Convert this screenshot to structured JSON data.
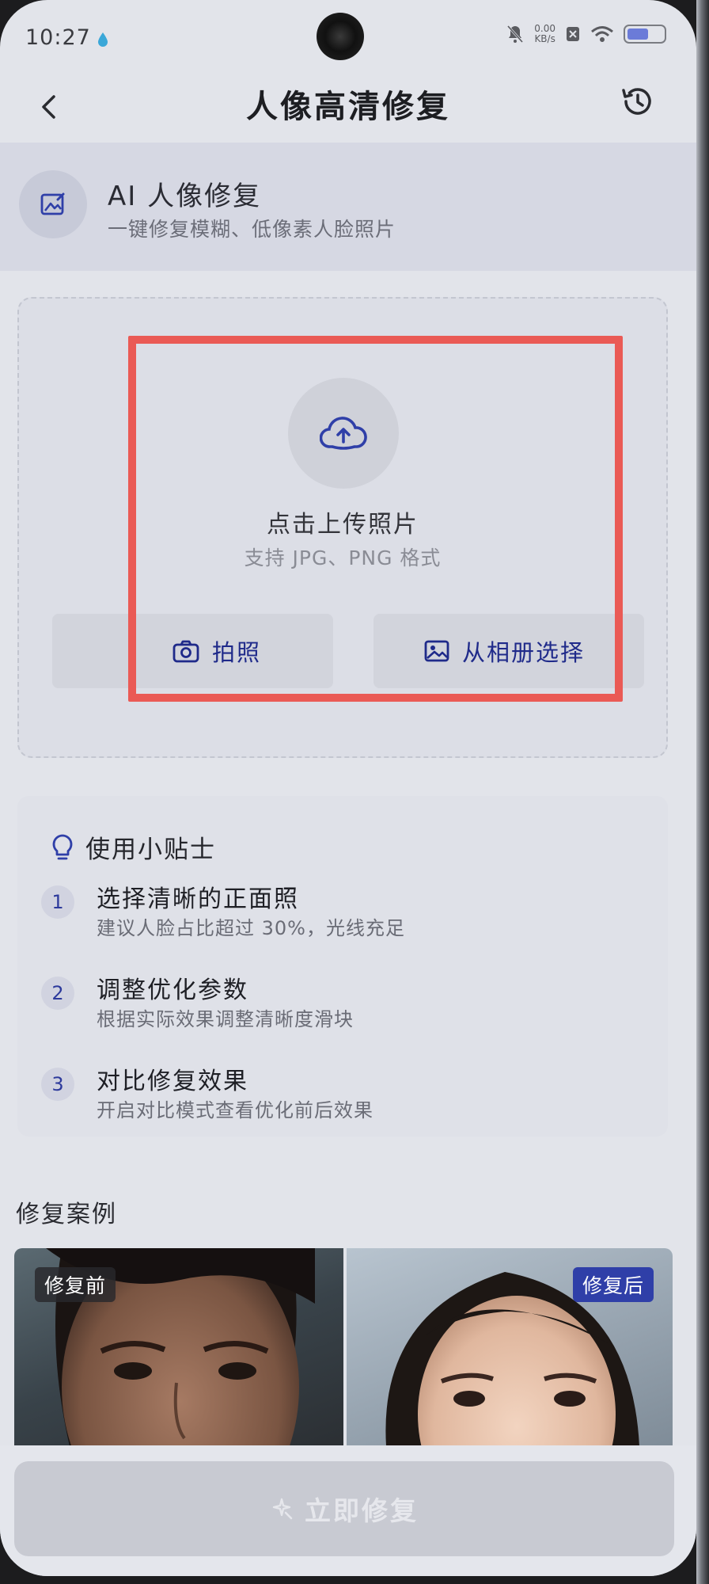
{
  "status_bar": {
    "time": "10:27",
    "net_speed_value": "0.00",
    "net_speed_unit": "KB/s"
  },
  "header": {
    "title": "人像高清修复"
  },
  "banner": {
    "title": "AI 人像修复",
    "subtitle": "一键修复模糊、低像素人脸照片"
  },
  "upload": {
    "title": "点击上传照片",
    "subtitle": "支持 JPG、PNG 格式",
    "camera_label": "拍照",
    "album_label": "从相册选择"
  },
  "tips": {
    "heading": "使用小贴士",
    "items": [
      {
        "num": "1",
        "title": "选择清晰的正面照",
        "desc": "建议人脸占比超过 30%，光线充足"
      },
      {
        "num": "2",
        "title": "调整优化参数",
        "desc": "根据实际效果调整清晰度滑块"
      },
      {
        "num": "3",
        "title": "对比修复效果",
        "desc": "开启对比模式查看优化前后效果"
      }
    ]
  },
  "cases": {
    "title": "修复案例",
    "before_label": "修复前",
    "after_label": "修复后"
  },
  "action": {
    "fix_label": "立即修复"
  },
  "colors": {
    "accent": "#2f3fa8",
    "highlight": "#ea5a55",
    "background": "#e2e4ea"
  }
}
